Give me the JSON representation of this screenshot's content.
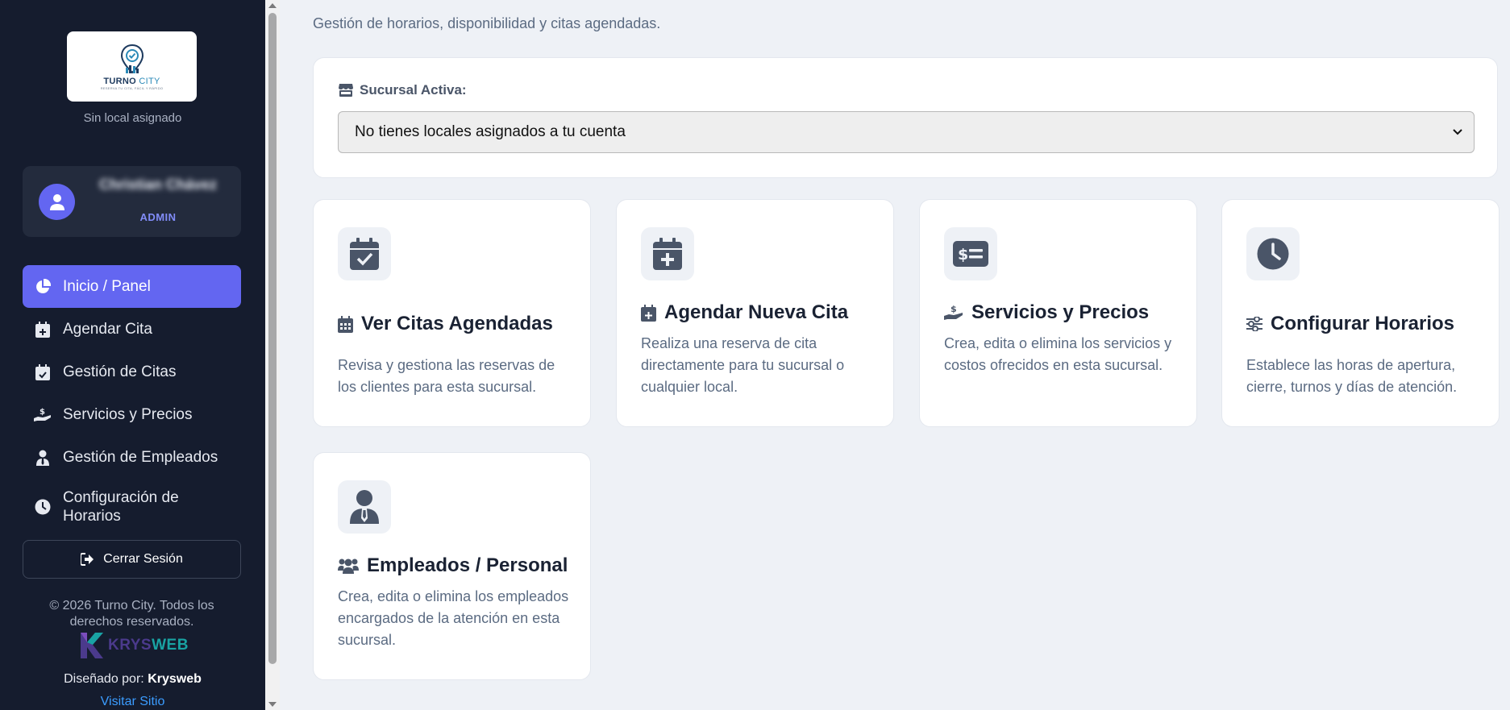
{
  "sidebar": {
    "logo": {
      "brand": "TURNO",
      "brand_accent": "CITY",
      "tagline": "RESERVA TU CITA, FÁCIL Y RÁPIDO"
    },
    "no_local": "Sin local asignado",
    "user": {
      "name": "Christian Chávez",
      "role": "ADMIN"
    },
    "nav": [
      {
        "label": "Inicio / Panel",
        "icon": "chart-pie-icon",
        "active": true
      },
      {
        "label": "Agendar Cita",
        "icon": "calendar-plus-icon",
        "active": false
      },
      {
        "label": "Gestión de Citas",
        "icon": "calendar-check-icon",
        "active": false
      },
      {
        "label": "Servicios y Precios",
        "icon": "hand-holding-dollar-icon",
        "active": false
      },
      {
        "label": "Gestión de Empleados",
        "icon": "user-tie-icon",
        "active": false
      },
      {
        "label": "Configuración de Horarios",
        "icon": "clock-icon",
        "active": false
      }
    ],
    "logout": "Cerrar Sesión",
    "copyright": "© 2026 Turno City. Todos los derechos reservados.",
    "krysweb_logo": {
      "part1": "KRYS",
      "part2": "WEB"
    },
    "designed_by_prefix": "Diseñado por:",
    "designed_by_name": "Krysweb",
    "visit_site": "Visitar Sitio"
  },
  "main": {
    "subtitle": "Gestión de horarios, disponibilidad y citas agendadas.",
    "branch": {
      "label": "Sucursal Activa:",
      "selected": "No tienes locales asignados a tu cuenta"
    },
    "cards": [
      {
        "title": "Ver Citas Agendadas",
        "description": "Revisa y gestiona las reservas de los clientes para esta sucursal.",
        "icon": "calendar-check-icon",
        "title_icon": "calendar-days-icon"
      },
      {
        "title": "Agendar Nueva Cita",
        "description": "Realiza una reserva de cita directamente para tu sucursal o cualquier local.",
        "icon": "calendar-plus-icon",
        "title_icon": "calendar-plus-icon"
      },
      {
        "title": "Servicios y Precios",
        "description": "Crea, edita o elimina los servicios y costos ofrecidos en esta sucursal.",
        "icon": "money-check-dollar-icon",
        "title_icon": "hand-holding-dollar-icon"
      },
      {
        "title": "Configurar Horarios",
        "description": "Establece las horas de apertura, cierre, turnos y días de atención.",
        "icon": "clock-icon",
        "title_icon": "sliders-icon"
      },
      {
        "title": "Empleados / Personal",
        "description": "Crea, edita o elimina los empleados encargados de la atención en esta sucursal.",
        "icon": "user-tie-icon",
        "title_icon": "users-icon"
      }
    ]
  },
  "colors": {
    "sidebar_bg": "#151c2e",
    "accent": "#6366f1",
    "page_bg": "#eef1f6",
    "card_bg": "#ffffff",
    "icon_color": "#4a5568"
  }
}
